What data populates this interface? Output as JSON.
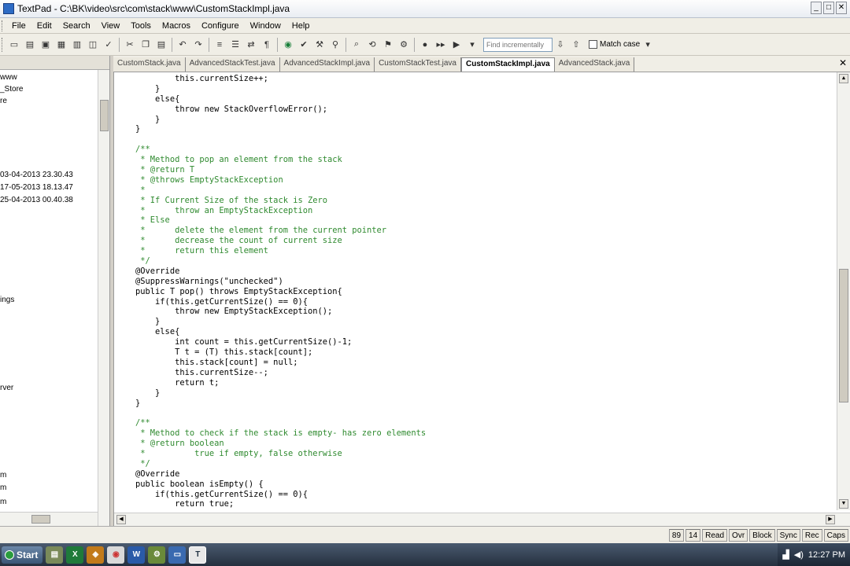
{
  "window": {
    "title": "TextPad - C:\\BK\\video\\src\\com\\stack\\www\\CustomStackImpl.java"
  },
  "menu": [
    "File",
    "Edit",
    "Search",
    "View",
    "Tools",
    "Macros",
    "Configure",
    "Window",
    "Help"
  ],
  "toolbar": {
    "find_placeholder": "Find incrementally",
    "match_case_label": "Match case"
  },
  "tabs": [
    "CustomStack.java",
    "AdvancedStackTest.java",
    "AdvancedStackImpl.java",
    "CustomStackTest.java",
    "CustomStackImpl.java",
    "AdvancedStack.java"
  ],
  "active_tab": "CustomStackImpl.java",
  "left_pane": {
    "items": [
      "www",
      "_Store",
      "re",
      "03-04-2013 23.30.43",
      "17-05-2013 18.13.47",
      "25-04-2013 00.40.38",
      "ings",
      "rver",
      "m",
      "m",
      "m"
    ]
  },
  "editor": {
    "lines": [
      {
        "t": "            this.currentSize++;",
        "c": false
      },
      {
        "t": "        }",
        "c": false
      },
      {
        "t": "        else{",
        "c": false
      },
      {
        "t": "            throw new StackOverflowError();",
        "c": false
      },
      {
        "t": "        }",
        "c": false
      },
      {
        "t": "    }",
        "c": false
      },
      {
        "t": "",
        "c": false
      },
      {
        "t": "    /**",
        "c": true
      },
      {
        "t": "     * Method to pop an element from the stack",
        "c": true
      },
      {
        "t": "     * @return T",
        "c": true
      },
      {
        "t": "     * @throws EmptyStackException",
        "c": true
      },
      {
        "t": "     *",
        "c": true
      },
      {
        "t": "     * If Current Size of the stack is Zero",
        "c": true
      },
      {
        "t": "     *      throw an EmptyStackException",
        "c": true
      },
      {
        "t": "     * Else",
        "c": true
      },
      {
        "t": "     *      delete the element from the current pointer",
        "c": true
      },
      {
        "t": "     *      decrease the count of current size",
        "c": true
      },
      {
        "t": "     *      return this element",
        "c": true
      },
      {
        "t": "     */",
        "c": true
      },
      {
        "t": "    @Override",
        "c": false
      },
      {
        "t": "    @SuppressWarnings(\"unchecked\")",
        "c": false
      },
      {
        "t": "    public T pop() throws EmptyStackException{",
        "c": false
      },
      {
        "t": "        if(this.getCurrentSize() == 0){",
        "c": false
      },
      {
        "t": "            throw new EmptyStackException();",
        "c": false
      },
      {
        "t": "        }",
        "c": false
      },
      {
        "t": "        else{",
        "c": false
      },
      {
        "t": "            int count = this.getCurrentSize()-1;",
        "c": false
      },
      {
        "t": "            T t = (T) this.stack[count];",
        "c": false
      },
      {
        "t": "            this.stack[count] = null;",
        "c": false
      },
      {
        "t": "            this.currentSize--;",
        "c": false
      },
      {
        "t": "            return t;",
        "c": false
      },
      {
        "t": "        }",
        "c": false
      },
      {
        "t": "    }",
        "c": false
      },
      {
        "t": "",
        "c": false
      },
      {
        "t": "    /**",
        "c": true
      },
      {
        "t": "     * Method to check if the stack is empty- has zero elements",
        "c": true
      },
      {
        "t": "     * @return boolean",
        "c": true
      },
      {
        "t": "     *          true if empty, false otherwise",
        "c": true
      },
      {
        "t": "     */",
        "c": true
      },
      {
        "t": "    @Override",
        "c": false
      },
      {
        "t": "    public boolean isEmpty() {",
        "c": false
      },
      {
        "t": "        if(this.getCurrentSize() == 0){",
        "c": false
      },
      {
        "t": "            return true;",
        "c": false
      }
    ]
  },
  "status": [
    "89",
    "14",
    "Read",
    "Ovr",
    "Block",
    "Sync",
    "Rec",
    "Caps"
  ],
  "taskbar": {
    "start_label": "Start",
    "clock": "12:27 PM"
  }
}
